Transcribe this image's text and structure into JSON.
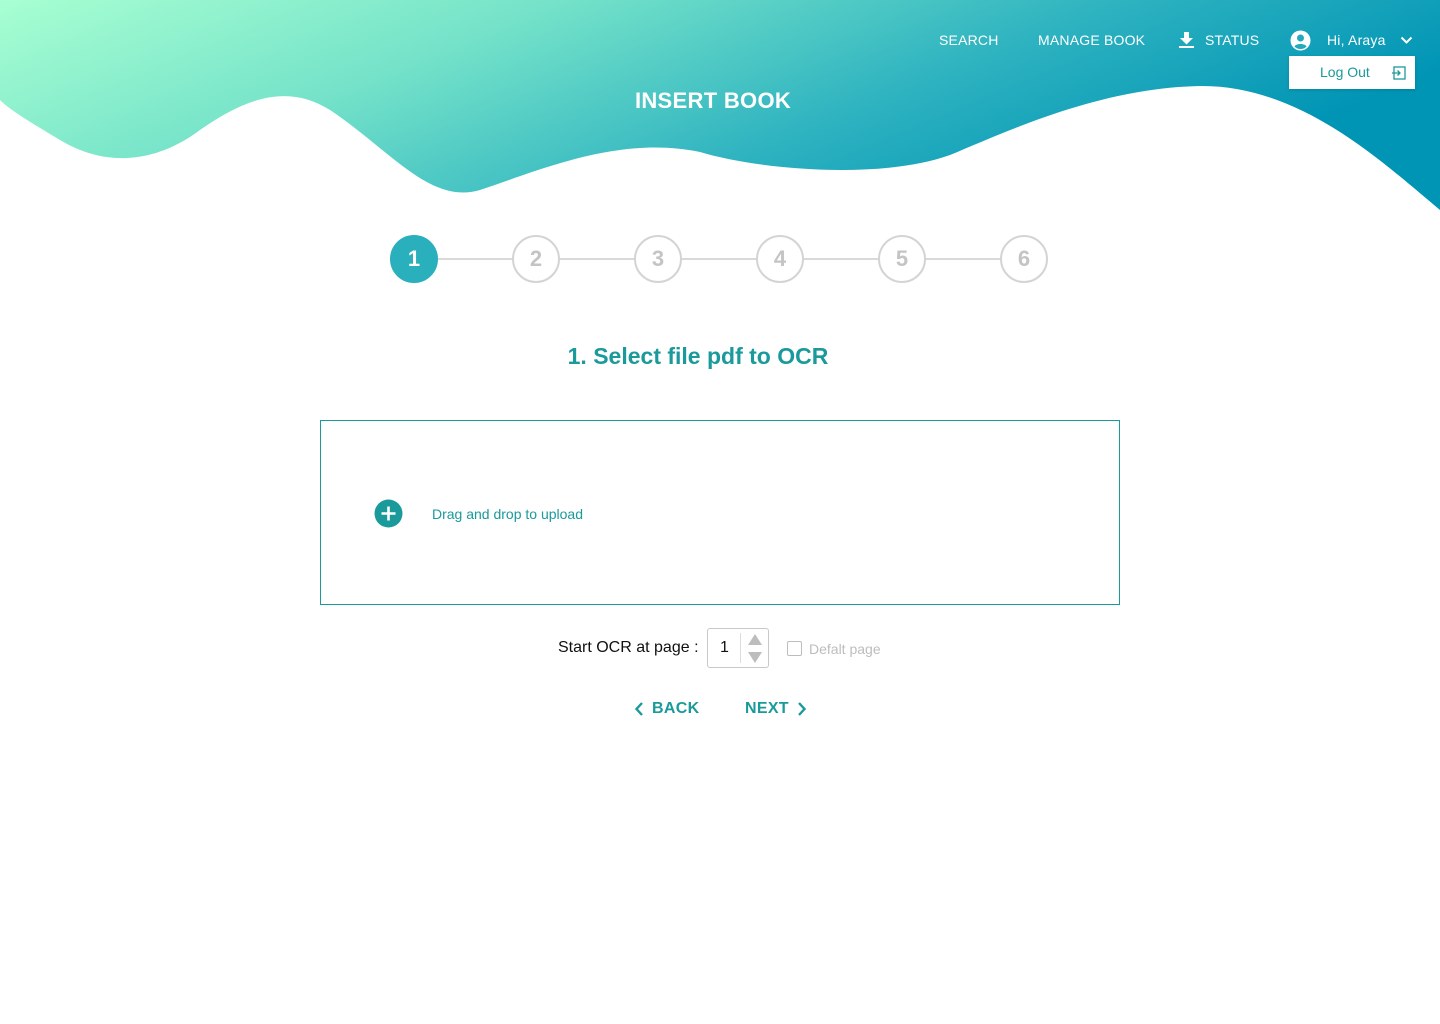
{
  "nav": {
    "search_label": "SEARCH",
    "manage_book_label": "MANAGE BOOK",
    "status_label": "STATUS",
    "status_icon": "download-icon",
    "user_greeting": "Hi, Araya",
    "user_icon": "account-circle-icon",
    "dropdown_icon": "chevron-down-icon",
    "logout_label": "Log Out",
    "logout_icon": "logout-icon"
  },
  "header": {
    "title": "INSERT BOOK",
    "gradient_colors": [
      "#a6ffd3",
      "#6fdfc8",
      "#2bb3c0",
      "#0096b6"
    ]
  },
  "stepper": {
    "steps": [
      "1",
      "2",
      "3",
      "4",
      "5",
      "6"
    ],
    "active_step": 1,
    "active_color": "#2aafbd"
  },
  "main": {
    "section_title": "1. Select file pdf to OCR",
    "dropzone_text": "Drag and drop to upload",
    "dropzone_icon": "add-circle-icon",
    "ocr_label": "Start OCR at page :",
    "start_page_value": "1",
    "default_page_label": "Defalt page",
    "default_page_checked": false,
    "back_label": "BACK",
    "next_label": "NEXT",
    "accent_color": "#1a9a9a"
  }
}
